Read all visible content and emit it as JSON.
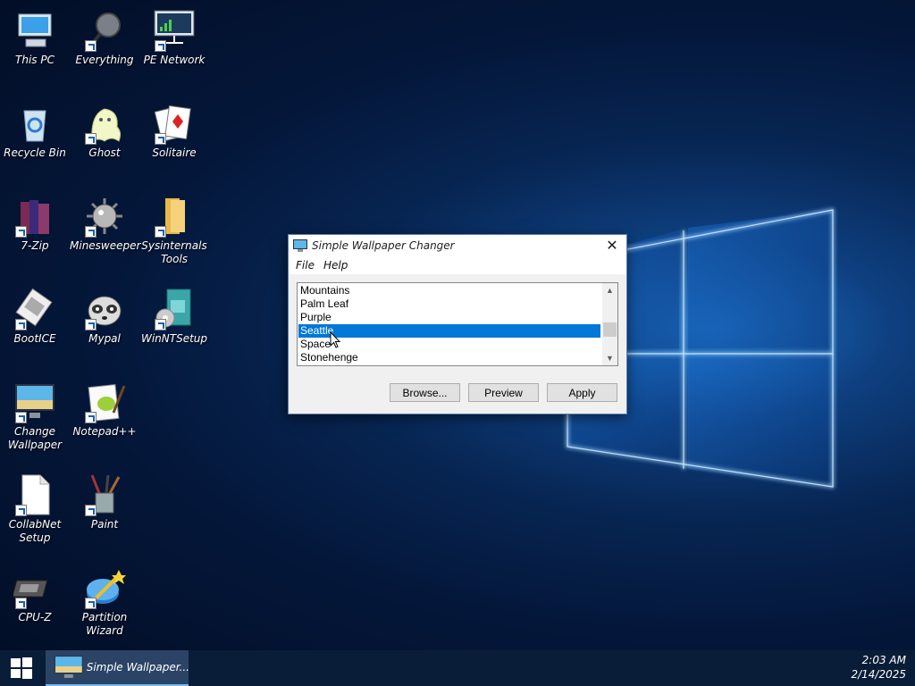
{
  "desktop": {
    "icons": [
      {
        "label": "This PC",
        "icon": "computer-icon"
      },
      {
        "label": "Everything",
        "icon": "magnifier-icon"
      },
      {
        "label": "PE Network",
        "icon": "network-icon"
      },
      {
        "label": "Recycle Bin",
        "icon": "recycle-bin-icon"
      },
      {
        "label": "Ghost",
        "icon": "ghost-icon"
      },
      {
        "label": "Solitaire",
        "icon": "cards-icon"
      },
      {
        "label": "7-Zip",
        "icon": "archive-icon"
      },
      {
        "label": "Minesweeper",
        "icon": "mine-icon"
      },
      {
        "label": "Sysinternals Tools",
        "icon": "folder-icon"
      },
      {
        "label": "BootICE",
        "icon": "disk-tool-icon"
      },
      {
        "label": "Mypal",
        "icon": "raccoon-icon"
      },
      {
        "label": "WinNTSetup",
        "icon": "setup-icon"
      },
      {
        "label": "Change Wallpaper",
        "icon": "monitor-icon"
      },
      {
        "label": "Notepad++",
        "icon": "notepad-icon"
      },
      {
        "label": "CollabNet Setup",
        "icon": "file-icon"
      },
      {
        "label": "Paint",
        "icon": "paint-icon"
      },
      {
        "label": "CPU-Z",
        "icon": "cpu-icon"
      },
      {
        "label": "Partition Wizard",
        "icon": "partition-wizard-icon"
      }
    ]
  },
  "dialog": {
    "title": "Simple Wallpaper Changer",
    "close_glyph": "✕",
    "menu": [
      "File",
      "Help"
    ],
    "list_items": [
      "Mountains",
      "Palm Leaf",
      "Purple",
      "Seattle",
      "Space",
      "Stonehenge"
    ],
    "selected_item": "Seattle",
    "buttons": {
      "browse": "Browse...",
      "preview": "Preview",
      "apply": "Apply"
    }
  },
  "taskbar": {
    "start_icon": "windows-logo-icon",
    "task_label": "Simple Wallpaper...",
    "clock_time": "2:03 AM",
    "clock_date": "2/14/2025"
  },
  "colors": {
    "selection": "#0078d7",
    "taskbar": "#0a1d38"
  }
}
